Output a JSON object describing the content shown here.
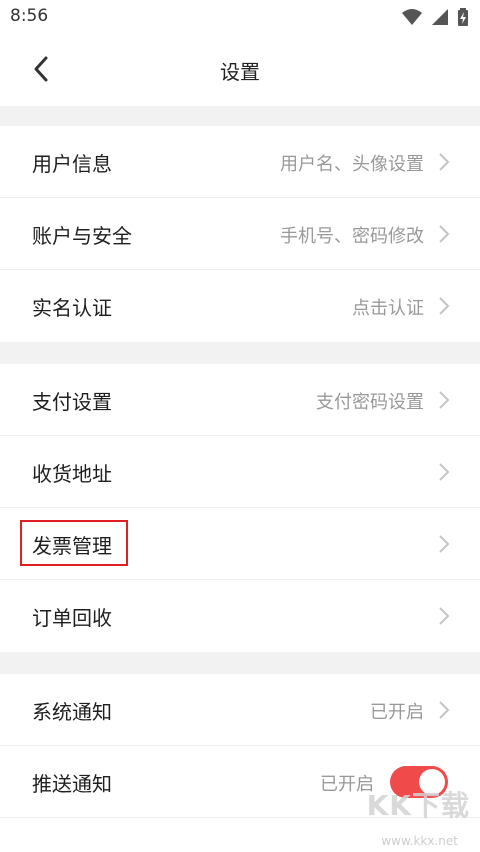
{
  "status": {
    "time": "8:56"
  },
  "nav": {
    "title": "设置"
  },
  "group1": [
    {
      "label": "用户信息",
      "value": "用户名、头像设置"
    },
    {
      "label": "账户与安全",
      "value": "手机号、密码修改"
    },
    {
      "label": "实名认证",
      "value": "点击认证"
    }
  ],
  "group2": [
    {
      "label": "支付设置",
      "value": "支付密码设置"
    },
    {
      "label": "收货地址",
      "value": ""
    },
    {
      "label": "发票管理",
      "value": ""
    },
    {
      "label": "订单回收",
      "value": ""
    }
  ],
  "group3": [
    {
      "label": "系统通知",
      "value": "已开启"
    },
    {
      "label": "推送通知",
      "value": "已开启"
    }
  ],
  "watermark": {
    "brand": "KK下载",
    "site": "www.kkx.net"
  },
  "colors": {
    "accent": "#f04a4a",
    "highlight": "#e02020"
  }
}
